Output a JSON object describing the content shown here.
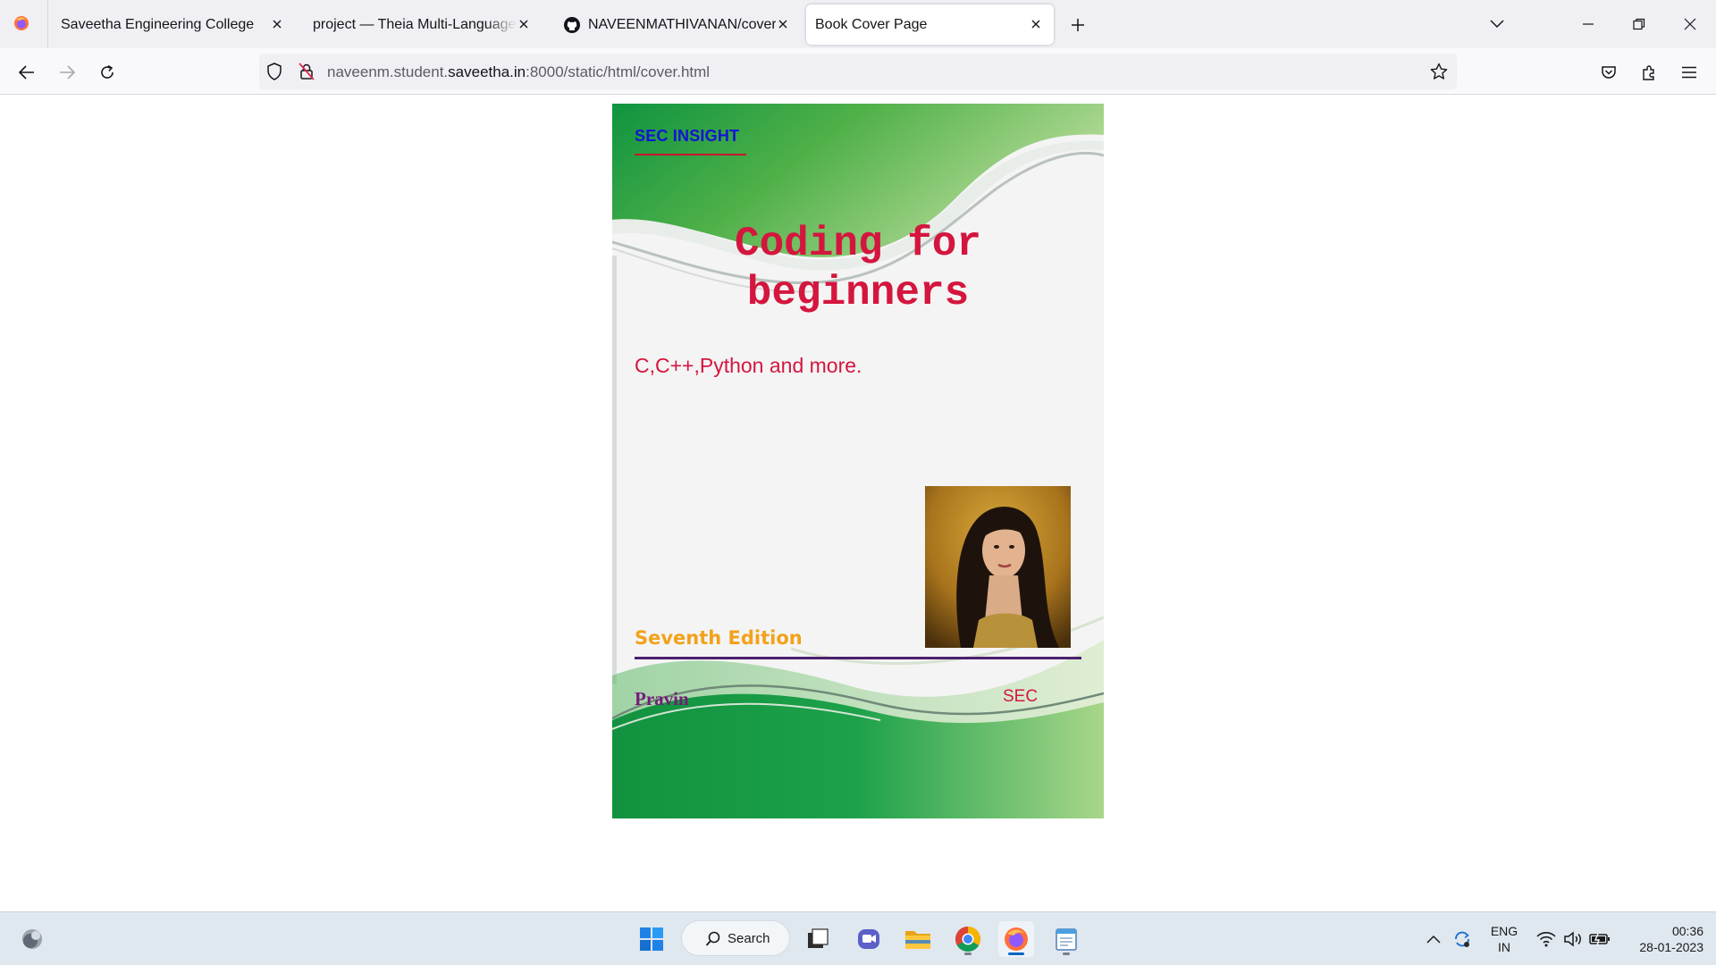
{
  "browser": {
    "tabs": [
      {
        "label": "Saveetha Engineering College",
        "active": false
      },
      {
        "label": "project — Theia Multi-Language Ex",
        "active": false
      },
      {
        "label": "NAVEENMATHIVANAN/cover",
        "active": false
      },
      {
        "label": "Book Cover Page",
        "active": true
      }
    ],
    "url": {
      "prefix": "naveenm.student.",
      "host": "saveetha.in",
      "suffix": ":8000/static/html/cover.html"
    }
  },
  "cover": {
    "brand": "SEC INSIGHT",
    "title_line1": "Coding for",
    "title_line2": "beginners",
    "subtitle": "C,C++,Python and more.",
    "edition": "Seventh Edition",
    "author": "Pravin",
    "publisher": "SEC",
    "colors": {
      "brand": "#1414d4",
      "title": "#d4163e",
      "edition": "#f2a21b",
      "author": "#761b7a",
      "green": "#1f9e4a"
    }
  },
  "taskbar": {
    "search_label": "Search",
    "apps": [
      "widgets-icon",
      "start-icon",
      "search",
      "task-view-icon",
      "teams-chat-icon",
      "file-explorer-icon",
      "chrome-icon",
      "firefox-icon",
      "notepad-app-icon"
    ],
    "language_line1": "ENG",
    "language_line2": "IN",
    "time": "00:36",
    "date": "28-01-2023"
  }
}
